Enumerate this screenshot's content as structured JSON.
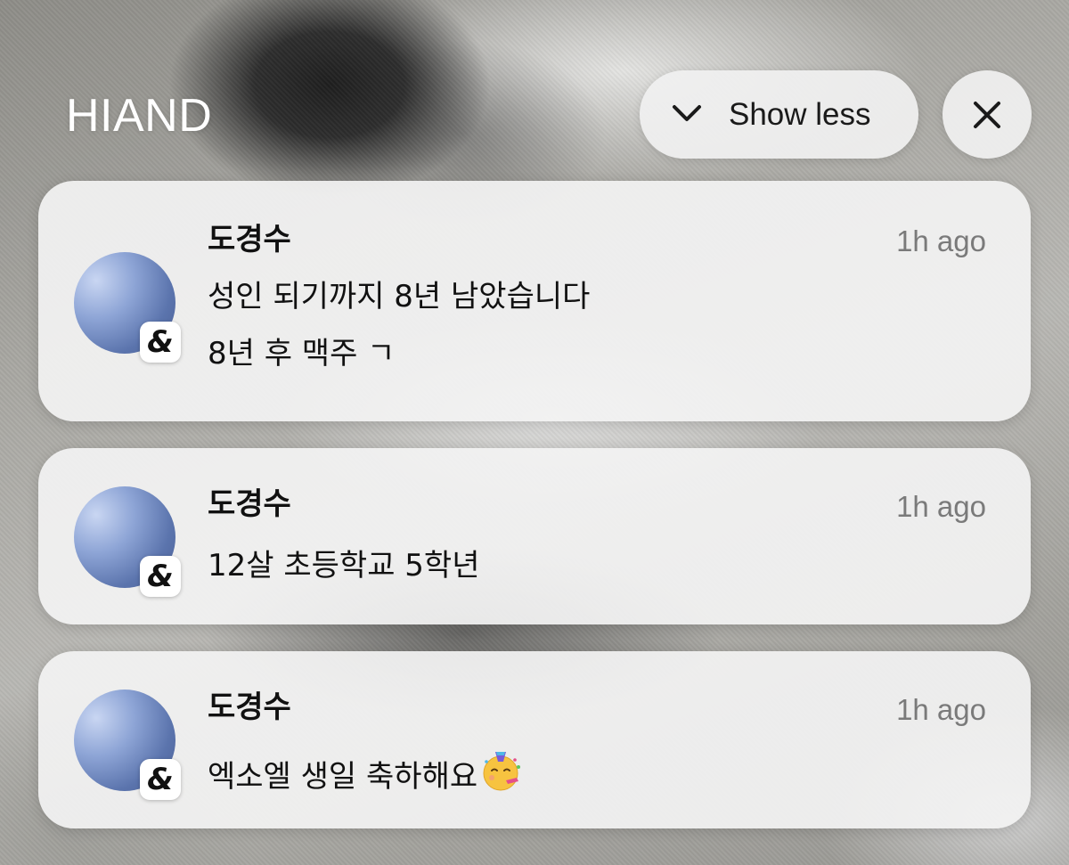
{
  "app": {
    "name": "HIAND"
  },
  "controls": {
    "show_less_label": "Show less",
    "chevron_icon": "chevron-down-icon",
    "close_icon": "close-icon"
  },
  "notifications": [
    {
      "sender": "도경수",
      "time": "1h ago",
      "lines": [
        "성인 되기까지 8년 남았습니다",
        "8년 후 맥주 ㄱ"
      ],
      "badge_icon": "ampersand-app-icon"
    },
    {
      "sender": "도경수",
      "time": "1h ago",
      "lines": [
        "12살 초등학교 5학년"
      ],
      "badge_icon": "ampersand-app-icon"
    },
    {
      "sender": "도경수",
      "time": "1h ago",
      "lines": [
        "엑소엘 생일 축하해요"
      ],
      "trailing_emoji": "partying-face-icon",
      "badge_icon": "ampersand-app-icon"
    }
  ],
  "colors": {
    "card_bg": "#f3f3f3",
    "text_primary": "#111111",
    "text_secondary": "#7a7a7a",
    "avatar": "#5b74ad"
  }
}
